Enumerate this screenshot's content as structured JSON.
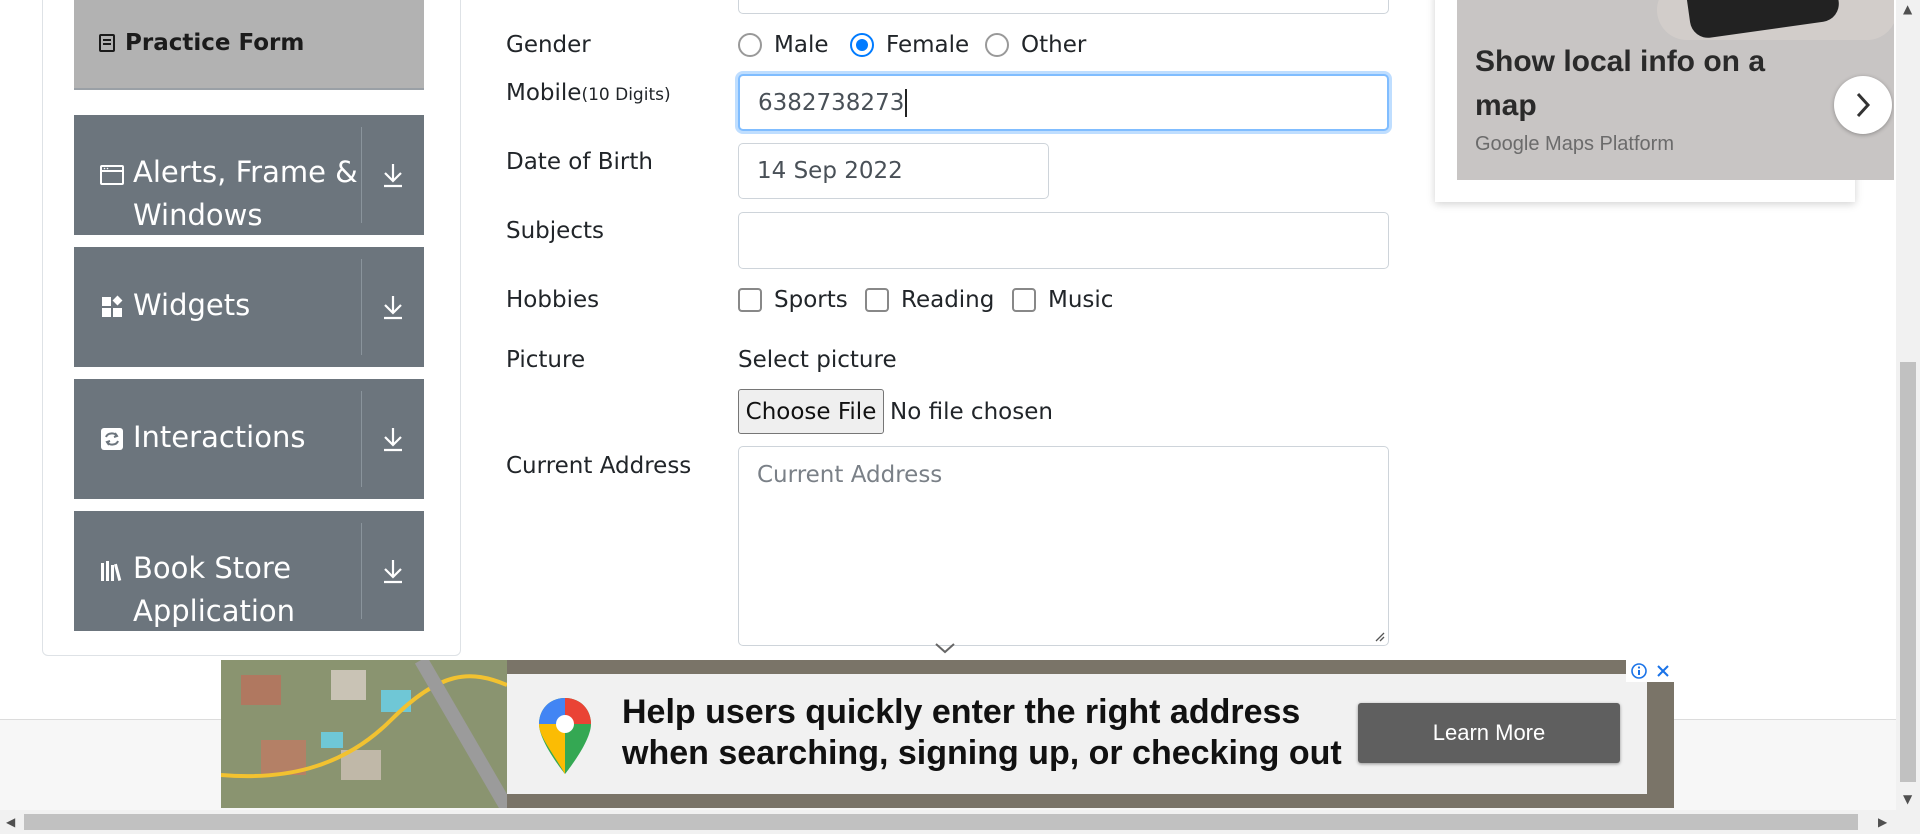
{
  "sidebar": {
    "practice_form": "Practice Form",
    "groups": [
      {
        "label_lines": [
          "Alerts, Frame &",
          "Windows"
        ],
        "icon": "window-icon"
      },
      {
        "label_lines": [
          "Widgets"
        ],
        "icon": "widgets-icon"
      },
      {
        "label_lines": [
          "Interactions"
        ],
        "icon": "interactions-icon"
      },
      {
        "label_lines": [
          "Book Store",
          "Application"
        ],
        "icon": "books-icon"
      }
    ]
  },
  "form": {
    "gender_label": "Gender",
    "gender_options": [
      "Male",
      "Female",
      "Other"
    ],
    "gender_selected": "Female",
    "mobile_label": "Mobile",
    "mobile_hint": "(10 Digits)",
    "mobile_value": "6382738273",
    "dob_label": "Date of Birth",
    "dob_value": "14 Sep 2022",
    "subjects_label": "Subjects",
    "subjects_value": "",
    "hobbies_label": "Hobbies",
    "hobbies": [
      "Sports",
      "Reading",
      "Music"
    ],
    "picture_label": "Picture",
    "select_picture": "Select picture",
    "choose_file": "Choose File",
    "no_file": "No file chosen",
    "address_label": "Current Address",
    "address_placeholder": "Current Address"
  },
  "ad_right": {
    "headline": "Show local info on a map",
    "sub": "Google Maps Platform"
  },
  "banner": {
    "line1": "Help users quickly enter the right address",
    "line2": "when searching, signing up, or checking out",
    "cta": "Learn More"
  },
  "colors": {
    "sidebar_group": "#6c757d",
    "accent": "#007bff",
    "focus_border": "#80bdff"
  }
}
